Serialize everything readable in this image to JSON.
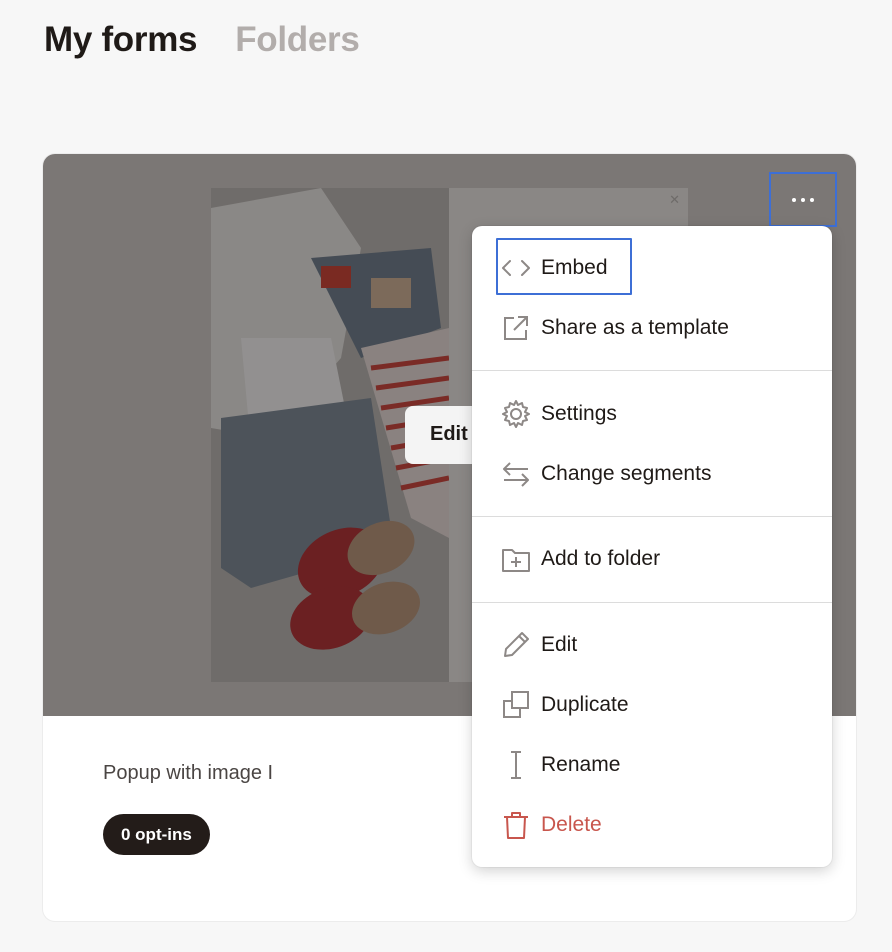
{
  "tabs": [
    {
      "label": "My forms",
      "active": true
    },
    {
      "label": "Folders",
      "active": false
    }
  ],
  "card": {
    "preview_edit_label": "Edit",
    "form_name": "Popup with image I",
    "optins_badge": "0 opt-ins",
    "more_icon": "ellipsis-icon"
  },
  "menu": {
    "groups": [
      [
        {
          "label": "Embed",
          "icon": "code-icon",
          "focused": true
        },
        {
          "label": "Share as a template",
          "icon": "external-link-icon"
        }
      ],
      [
        {
          "label": "Settings",
          "icon": "gear-icon"
        },
        {
          "label": "Change segments",
          "icon": "swap-arrows-icon"
        }
      ],
      [
        {
          "label": "Add to folder",
          "icon": "folder-plus-icon"
        }
      ],
      [
        {
          "label": "Edit",
          "icon": "pencil-icon"
        },
        {
          "label": "Duplicate",
          "icon": "duplicate-icon"
        },
        {
          "label": "Rename",
          "icon": "text-cursor-icon"
        },
        {
          "label": "Delete",
          "icon": "trash-icon",
          "danger": true
        }
      ]
    ]
  },
  "colors": {
    "accent_focus": "#3d6fd6",
    "danger": "#c8564d",
    "badge_bg": "#231c19"
  }
}
